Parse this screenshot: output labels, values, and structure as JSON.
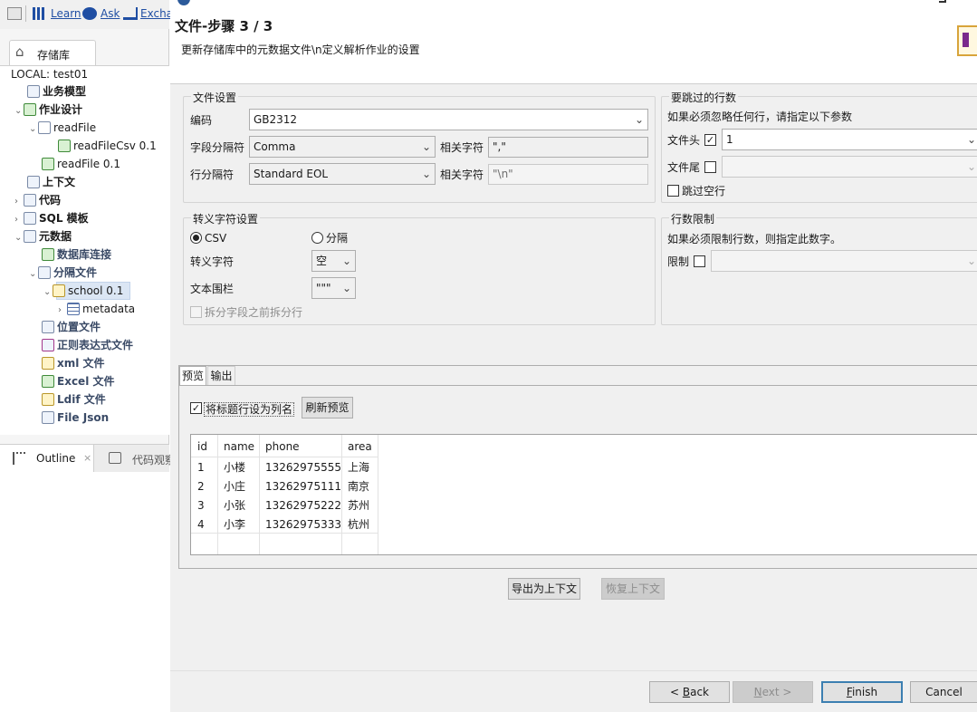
{
  "toolbar": {
    "links": [
      "Learn",
      "Ask",
      "Excha"
    ]
  },
  "repository": {
    "tab_label": "存储库",
    "local_label": "LOCAL: test01",
    "tree": [
      {
        "label": "业务模型",
        "bold": true
      },
      {
        "label": "作业设计",
        "bold": true
      },
      {
        "label": "readFile"
      },
      {
        "label": "readFileCsv 0.1"
      },
      {
        "label": "readFile 0.1"
      },
      {
        "label": "上下文",
        "bold": true
      },
      {
        "label": "代码",
        "bold": true
      },
      {
        "label": "SQL 模板",
        "bold": true
      },
      {
        "label": "元数据",
        "bold": true
      },
      {
        "label": "数据库连接",
        "bold": true
      },
      {
        "label": "分隔文件",
        "bold": true
      },
      {
        "label": "school 0.1"
      },
      {
        "label": "metadata"
      },
      {
        "label": "位置文件",
        "bold": true
      },
      {
        "label": "正则表达式文件",
        "bold": true
      },
      {
        "label": "xml 文件",
        "bold": true
      },
      {
        "label": "Excel 文件",
        "bold": true
      },
      {
        "label": "Ldif 文件",
        "bold": true
      },
      {
        "label": "File Json",
        "bold": true
      }
    ]
  },
  "bottom_tabs": {
    "outline": "Outline",
    "code_view": "代码观察"
  },
  "dialog": {
    "title": "文件-步骤 3 / 3",
    "subtitle": "更新存储库中的元数据文件\\n定义解析作业的设置",
    "file_settings": {
      "legend": "文件设置",
      "encoding_label": "编码",
      "encoding_value": "GB2312",
      "field_sep_label": "字段分隔符",
      "field_sep_value": "Comma",
      "related_char_label": "相关字符",
      "field_sep_char": "\",\"",
      "row_sep_label": "行分隔符",
      "row_sep_value": "Standard EOL",
      "row_sep_char": "\"\\n\""
    },
    "skip_rows": {
      "legend": "要跳过的行数",
      "hint": "如果必须忽略任何行，请指定以下参数",
      "header_label": "文件头",
      "header_checked": true,
      "header_value": "1",
      "footer_label": "文件尾",
      "footer_checked": false,
      "skip_empty_label": "跳过空行",
      "skip_empty_checked": false
    },
    "escape": {
      "legend": "转义字符设置",
      "csv_label": "CSV",
      "delim_label": "分隔",
      "selected": "CSV",
      "escape_char_label": "转义字符",
      "escape_char_value": "空",
      "text_enclosure_label": "文本围栏",
      "text_enclosure_value": "\"\"\"",
      "split_label": "拆分字段之前拆分行"
    },
    "limit": {
      "legend": "行数限制",
      "hint": "如果必须限制行数，则指定此数字。",
      "limit_label": "限制",
      "limit_checked": false
    },
    "preview": {
      "tabs": [
        "预览",
        "输出"
      ],
      "header_as_col_label": "将标题行设为列名",
      "header_as_col_checked": true,
      "refresh_button": "刷新预览",
      "columns": [
        "id",
        "name",
        "phone",
        "area"
      ],
      "rows": [
        [
          "1",
          "小楼",
          "13262975555",
          "上海"
        ],
        [
          "2",
          "小庄",
          "13262975111",
          "南京"
        ],
        [
          "3",
          "小张",
          "13262975222",
          "苏州"
        ],
        [
          "4",
          "小李",
          "13262975333",
          "杭州"
        ]
      ]
    },
    "export_context_button": "导出为上下文",
    "restore_context_button": "恢复上下文",
    "nav": {
      "back_prefix": "< ",
      "back_key": "B",
      "back_rest": "ack",
      "next_key": "N",
      "next_rest": "ext >",
      "finish_key": "F",
      "finish_rest": "inish",
      "cancel": "Cancel"
    }
  }
}
